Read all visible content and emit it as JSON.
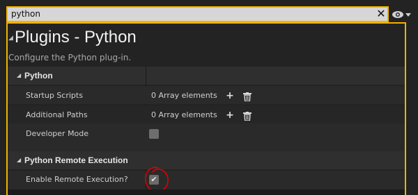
{
  "search": {
    "value": "python"
  },
  "title": "Plugins - Python",
  "description": "Configure the Python plug-in.",
  "sections": [
    {
      "label": "Python",
      "rows": [
        {
          "label": "Startup Scripts",
          "value": "0 Array elements"
        },
        {
          "label": "Additional Paths",
          "value": "0 Array elements"
        },
        {
          "label": "Developer Mode",
          "checked": false
        }
      ]
    },
    {
      "label": "Python Remote Execution",
      "rows": [
        {
          "label": "Enable Remote Execution?",
          "checked": true
        }
      ]
    }
  ],
  "colors": {
    "highlight": "#f0b400",
    "annotation": "#e00000"
  },
  "icons": [
    "close-icon",
    "eye-icon",
    "chevron-down-icon",
    "plus-icon",
    "trash-icon",
    "collapse-arrow-icon",
    "checkmark-icon"
  ]
}
